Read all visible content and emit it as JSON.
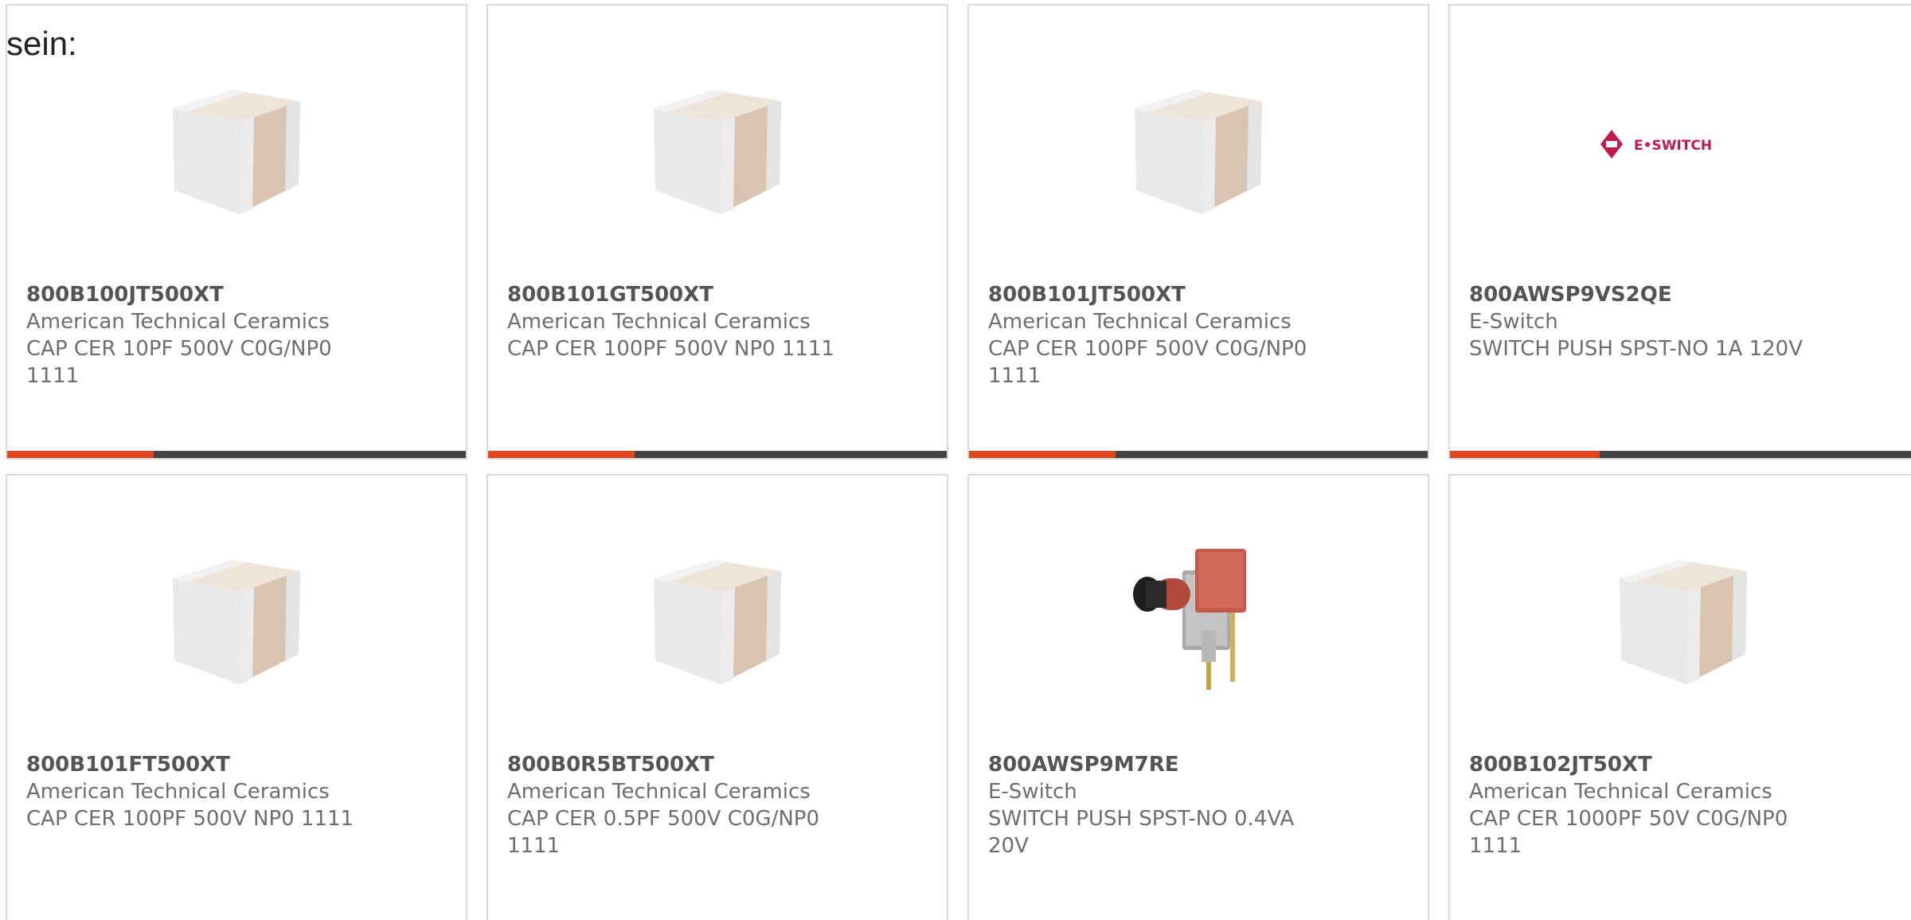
{
  "header_fragment": "sein:",
  "colors": {
    "accent_bar": "#e2461f",
    "bar_track": "#444444",
    "card_border": "#dadada",
    "part_number": "#545454",
    "body_text": "#6e6e6e"
  },
  "products": [
    {
      "part_number": "800B100JT500XT",
      "manufacturer": "American Technical Ceramics",
      "description": "CAP CER 10PF 500V C0G/NP0 1111",
      "image": "ceramic-capacitor-image",
      "progress": 0.32
    },
    {
      "part_number": "800B101GT500XT",
      "manufacturer": "American Technical Ceramics",
      "description": "CAP CER 100PF 500V NP0 1111",
      "image": "ceramic-capacitor-image",
      "progress": 0.32
    },
    {
      "part_number": "800B101JT500XT",
      "manufacturer": "American Technical Ceramics",
      "description": "CAP CER 100PF 500V C0G/NP0 1111",
      "image": "ceramic-capacitor-image",
      "progress": 0.32
    },
    {
      "part_number": "800AWSP9VS2QE",
      "manufacturer": "E-Switch",
      "description": "SWITCH PUSH SPST-NO 1A 120V",
      "image": "e-switch-logo",
      "logo_text": "E•SWITCH",
      "progress": 0.32
    },
    {
      "part_number": "800B101FT500XT",
      "manufacturer": "American Technical Ceramics",
      "description": "CAP CER 100PF 500V NP0 1111",
      "image": "ceramic-capacitor-image"
    },
    {
      "part_number": "800B0R5BT500XT",
      "manufacturer": "American Technical Ceramics",
      "description": "CAP CER 0.5PF 500V C0G/NP0 1111",
      "image": "ceramic-capacitor-image"
    },
    {
      "part_number": "800AWSP9M7RE",
      "manufacturer": "E-Switch",
      "description": "SWITCH PUSH SPST-NO 0.4VA 20V",
      "image": "push-switch-image"
    },
    {
      "part_number": "800B102JT50XT",
      "manufacturer": "American Technical Ceramics",
      "description": "CAP CER 1000PF 50V C0G/NP0 1111",
      "image": "ceramic-capacitor-image"
    }
  ]
}
